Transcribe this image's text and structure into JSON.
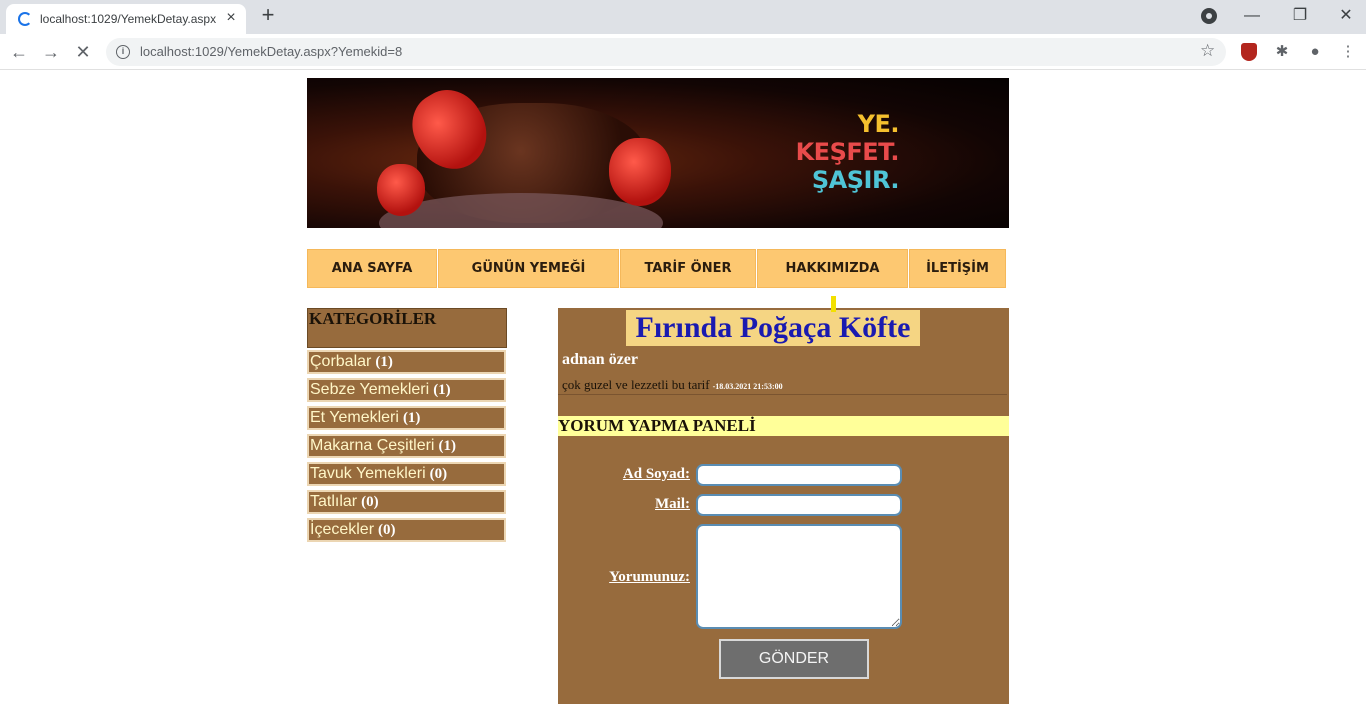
{
  "browser": {
    "tab_title": "localhost:1029/YemekDetay.aspx",
    "tab_close": "×",
    "new_tab": "+",
    "url": "localhost:1029/YemekDetay.aspx?Yemekid=8",
    "window_controls": {
      "minimize": "—",
      "restore": "❐",
      "close": "✕"
    },
    "nav": {
      "back": "←",
      "forward": "→",
      "stop": "✕"
    },
    "info_icon": "i",
    "star_icon": "☆",
    "extensions_icon": "✱",
    "profile_icon": "●",
    "menu_icon": "⋮"
  },
  "banner": {
    "line1": "YE.",
    "line2": "KEŞFET.",
    "line3": "ŞAŞIR."
  },
  "menu": [
    {
      "label": "ANA SAYFA"
    },
    {
      "label": "GÜNÜN YEMEĞİ"
    },
    {
      "label": "TARİF ÖNER"
    },
    {
      "label": "HAKKIMIZDA"
    },
    {
      "label": "İLETİŞİM"
    }
  ],
  "categories": {
    "heading": "KATEGORİLER",
    "items": [
      {
        "name": "Çorbalar",
        "count": "(1)"
      },
      {
        "name": "Sebze Yemekleri",
        "count": "(1)"
      },
      {
        "name": "Et Yemekleri",
        "count": "(1)"
      },
      {
        "name": "Makarna Çeşitleri",
        "count": "(1)"
      },
      {
        "name": "Tavuk Yemekleri",
        "count": "(0)"
      },
      {
        "name": "Tatlılar",
        "count": "(0)"
      },
      {
        "name": "İçecekler",
        "count": "(0)"
      }
    ]
  },
  "detail": {
    "title": "Fırında Poğaça Köfte",
    "author": "adnan özer",
    "comment": "çok guzel ve lezzetli bu tarif",
    "comment_date": "-18.03.2021 21:53:00"
  },
  "comment_panel": {
    "heading": "YORUM YAPMA PANELİ",
    "name_label": "Ad Soyad:",
    "mail_label": "Mail:",
    "comment_label": "Yorumunuz:",
    "name_value": "",
    "mail_value": "",
    "comment_value": "",
    "submit_label": "GÖNDER"
  }
}
